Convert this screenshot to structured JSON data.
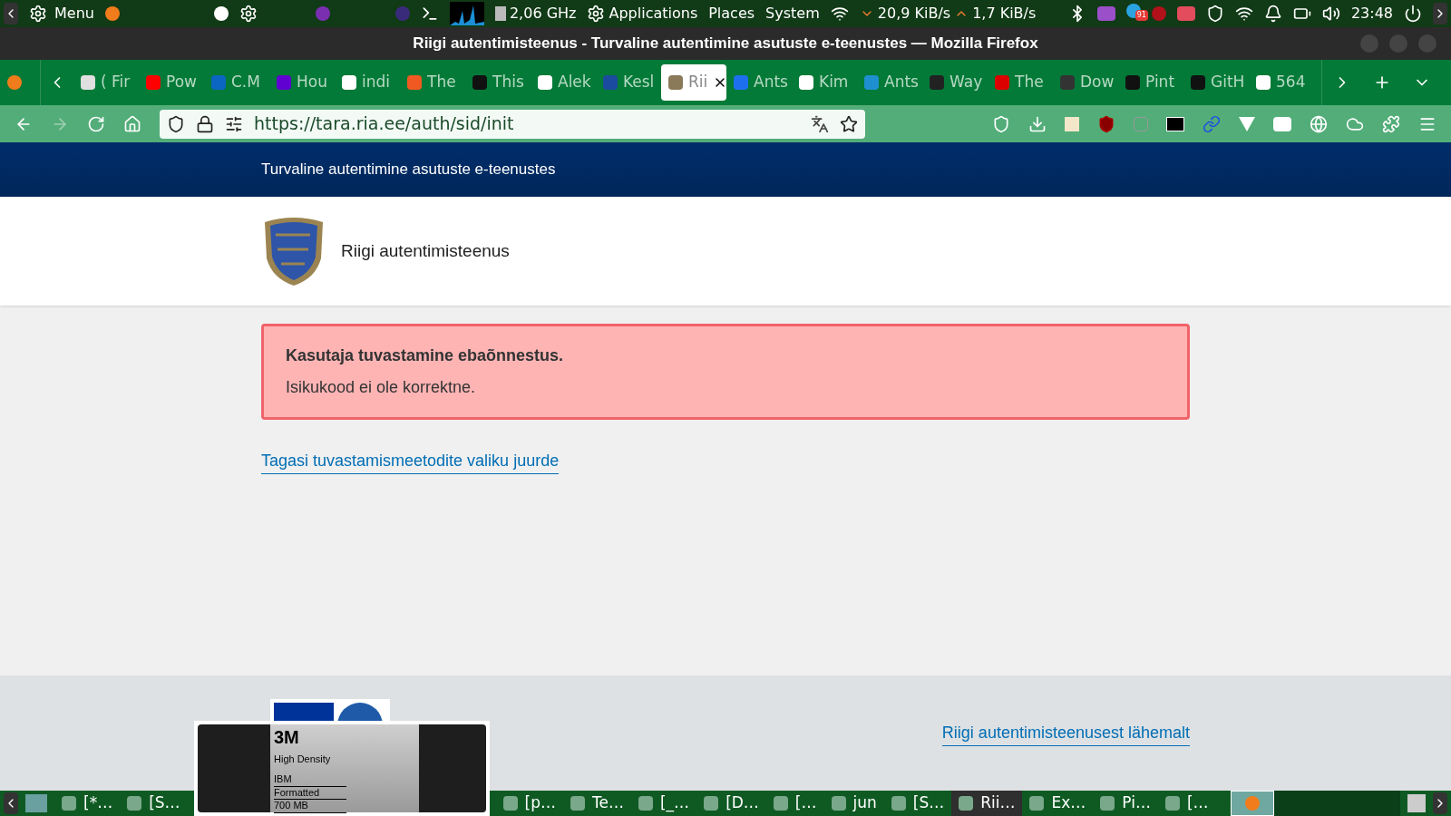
{
  "top_panel": {
    "menu": "Menu",
    "cpu": "2,06 GHz",
    "menus": [
      "Applications",
      "Places",
      "System"
    ],
    "download": "20,9 KiB/s",
    "upload": "1,7 KiB/s",
    "badge": "91",
    "clock": "23:48"
  },
  "window": {
    "title": "Riigi autentimisteenus - Turvaline autentimine asutuste e-teenustes — Mozilla Firefox"
  },
  "tabs": [
    {
      "label": "( Fir",
      "selected": false
    },
    {
      "label": "Pow",
      "selected": false
    },
    {
      "label": "C.M",
      "selected": false
    },
    {
      "label": "Hou",
      "selected": false
    },
    {
      "label": "indi",
      "selected": false
    },
    {
      "label": "The",
      "selected": false
    },
    {
      "label": "This",
      "selected": false
    },
    {
      "label": "Alek",
      "selected": false
    },
    {
      "label": "Kesl",
      "selected": false
    },
    {
      "label": "Rii",
      "selected": true
    },
    {
      "label": "Ants",
      "selected": false
    },
    {
      "label": "Kim",
      "selected": false
    },
    {
      "label": "Ants",
      "selected": false
    },
    {
      "label": "Way",
      "selected": false
    },
    {
      "label": "The",
      "selected": false
    },
    {
      "label": "Dow",
      "selected": false
    },
    {
      "label": "Pint",
      "selected": false
    },
    {
      "label": "GitH",
      "selected": false
    },
    {
      "label": "564",
      "selected": false
    }
  ],
  "address_bar": {
    "url": "https://tara.ria.ee/auth/sid/init"
  },
  "page": {
    "header": "Turvaline autentimine asutuste e-teenustes",
    "service_name": "Riigi autentimisteenus",
    "error": {
      "title": "Kasutaja tuvastamine ebaõnnestus.",
      "message": "Isikukood ei ole korrektne."
    },
    "back_link": "Tagasi tuvastamismeetodite valiku juurde",
    "footer_link": "Riigi autentimisteenusest lähemalt"
  },
  "floppy": {
    "brand": "3M",
    "lines": [
      "High Density",
      "IBM",
      "Formatted",
      "700 MB"
    ]
  },
  "taskbar": [
    {
      "label": "[*…",
      "selected": false
    },
    {
      "label": "[S…",
      "selected": false
    },
    {
      "label": "[p…",
      "selected": false
    },
    {
      "label": "Te…",
      "selected": false
    },
    {
      "label": "[_…",
      "selected": false
    },
    {
      "label": "[D…",
      "selected": false
    },
    {
      "label": "[…",
      "selected": false
    },
    {
      "label": "jun",
      "selected": false
    },
    {
      "label": "[S…",
      "selected": false
    },
    {
      "label": "Rii…",
      "selected": true
    },
    {
      "label": "Ex…",
      "selected": false
    },
    {
      "label": "Pi…",
      "selected": false
    },
    {
      "label": "[…",
      "selected": false
    }
  ]
}
